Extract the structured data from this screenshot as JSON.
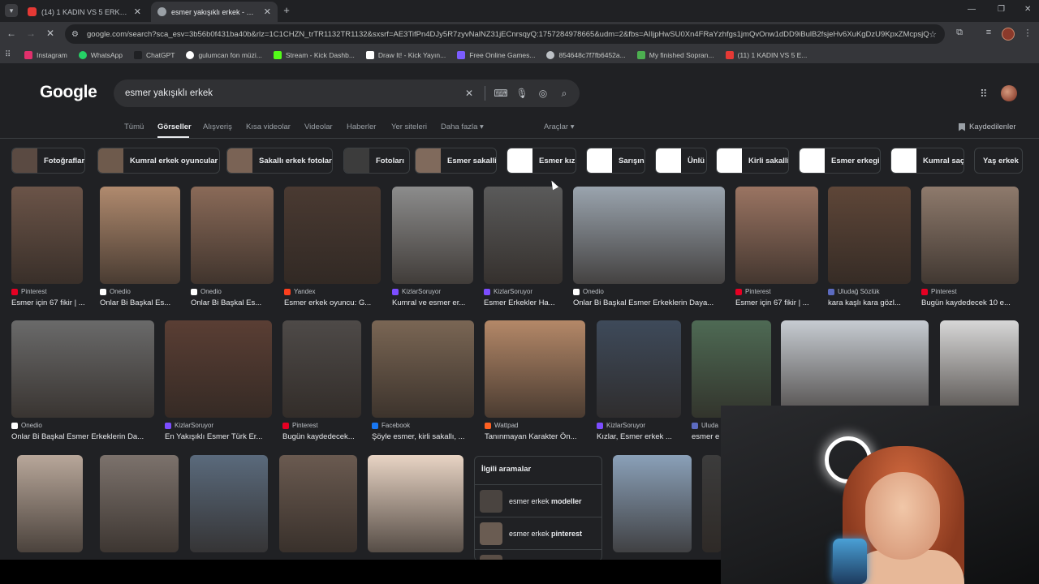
{
  "browser": {
    "tabs": [
      {
        "label": "(14) 1 KADIN VS 5 ERKEK | KIYA",
        "favicon_color": "#e53935",
        "active": false
      },
      {
        "label": "esmer yakışıklı erkek - Google'd",
        "favicon_color": "#9aa0a6",
        "active": true
      }
    ],
    "url": "google.com/search?sca_esv=3b56b0f431ba40b&rlz=1C1CHZN_trTR1132TR1132&sxsrf=AE3TifPn4DJy5R7zyvNalNZ31jECnrsqyQ:1757284978665&udm=2&fbs=AIIjpHwSU0Xn4FRaYzhfgs1jmQvOnw1dDD9iBulB2fsjeHv6XuKgDzU9KpxZMcpsjQNb1...",
    "bookmarks": [
      {
        "label": "Instagram",
        "color": "#e1306c"
      },
      {
        "label": "WhatsApp",
        "color": "#25d366"
      },
      {
        "label": "ChatGPT",
        "color": "#202124"
      },
      {
        "label": "gulumcan fon müzi...",
        "color": "#ffffff"
      },
      {
        "label": "Stream - Kick Dashb...",
        "color": "#53fc18"
      },
      {
        "label": "Draw It! - Kick Yayın...",
        "color": "#ffffff"
      },
      {
        "label": "Free Online Games...",
        "color": "#7b5cff"
      },
      {
        "label": "854648c7f7fb6452a...",
        "color": "#bdc1c6"
      },
      {
        "label": "My finished Sopran...",
        "color": "#4caf50"
      },
      {
        "label": "(11) 1 KADIN VS 5 E...",
        "color": "#e53935"
      }
    ]
  },
  "google": {
    "logo": "Google",
    "query": "esmer yakışıklı erkek",
    "nav_tabs": [
      "Tümü",
      "Görseller",
      "Alışveriş",
      "Kısa videolar",
      "Videolar",
      "Haberler",
      "Yer siteleri",
      "Daha fazla"
    ],
    "tools": "Araçlar",
    "saved": "Kaydedilenler",
    "chips": [
      {
        "label": "Fotoğrafları",
        "color": "#5a4a42"
      },
      {
        "label": "Kumral erkek oyuncular",
        "color": "#6e5a4c"
      },
      {
        "label": "Sakallı erkek fotoları",
        "color": "#7a6355"
      },
      {
        "label": "Fotoları",
        "color": "#3c3c3c"
      },
      {
        "label": "Esmer sakalli",
        "color": "#806a5c"
      },
      {
        "label": "Esmer kız",
        "color": "#ffffff"
      },
      {
        "label": "Sarışın",
        "color": "#ffffff"
      },
      {
        "label": "Ünlü",
        "color": "#ffffff"
      },
      {
        "label": "Kirli sakalli",
        "color": "#ffffff"
      },
      {
        "label": "Esmer erkegi",
        "color": "#ffffff"
      },
      {
        "label": "Kumral saç",
        "color": "#ffffff"
      },
      {
        "label": "Yaş erkek",
        "color": "#ffffff"
      }
    ],
    "row1": [
      {
        "source": "Pinterest",
        "caption": "Esmer için 67 fikir | ...",
        "src_color": "#e60023",
        "img": "#6b5448"
      },
      {
        "source": "Onedio",
        "caption": "Onlar Bi Başkal Es...",
        "src_color": "#ffffff",
        "img": "#b08a6e"
      },
      {
        "source": "Onedio",
        "caption": "Onlar Bi Başkal Es...",
        "src_color": "#ffffff",
        "img": "#8a6a58"
      },
      {
        "source": "Yandex",
        "caption": "Esmer erkek oyuncu: G...",
        "src_color": "#fc3f1d",
        "img": "#4a3a32"
      },
      {
        "source": "KizlarSoruyor",
        "caption": "Kumral ve esmer er...",
        "src_color": "#7c4dff",
        "img": "#8c8c8c"
      },
      {
        "source": "KizlarSoruyor",
        "caption": "Esmer Erkekler Ha...",
        "src_color": "#7c4dff",
        "img": "#5a5a5a"
      },
      {
        "source": "Onedio",
        "caption": "Onlar Bi Başkal Esmer Erkeklerin Daya...",
        "src_color": "#ffffff",
        "img": "#9aa4ae"
      },
      {
        "source": "Pinterest",
        "caption": "Esmer için 67 fikir | ...",
        "src_color": "#e60023",
        "img": "#9a7462"
      },
      {
        "source": "Uludağ Sözlük",
        "caption": "kara kaşlı kara gözl...",
        "src_color": "#5c6bc0",
        "img": "#5e4638"
      },
      {
        "source": "Pinterest",
        "caption": "Bugün kaydedecek 10 e...",
        "src_color": "#e60023",
        "img": "#8e7a6c"
      }
    ],
    "row2": [
      {
        "source": "Onedio",
        "caption": "Onlar Bi Başkal Esmer Erkeklerin Da...",
        "src_color": "#ffffff",
        "img": "#6a6a6a"
      },
      {
        "source": "KizlarSoruyor",
        "caption": "En Yakışıklı Esmer Türk Er...",
        "src_color": "#7c4dff",
        "img": "#5a3e34"
      },
      {
        "source": "Pinterest",
        "caption": "Bugün kaydedecek...",
        "src_color": "#e60023",
        "img": "#4e4a48"
      },
      {
        "source": "Facebook",
        "caption": "Şöyle esmer, kirli sakallı, ...",
        "src_color": "#1877f2",
        "img": "#7a6654"
      },
      {
        "source": "Wattpad",
        "caption": "Tanınmayan Karakter Ön...",
        "src_color": "#ff6122",
        "img": "#b48868"
      },
      {
        "source": "KizlarSoruyor",
        "caption": "Kızlar, Esmer erkek ...",
        "src_color": "#7c4dff",
        "img": "#3e4a5a"
      },
      {
        "source": "Uluda",
        "caption": "esmer e",
        "src_color": "#5c6bc0",
        "img": "#4e6a54"
      },
      {
        "source": "",
        "caption": "",
        "src_color": "#202124",
        "img": "#c7ccd2"
      },
      {
        "source": "",
        "caption": "",
        "src_color": "#202124",
        "img": "#d7d7d7"
      }
    ],
    "row3": [
      {
        "img": "#b8a79a"
      },
      {
        "img": "#7c726c"
      },
      {
        "img": "#5a6a7c"
      },
      {
        "img": "#6a5a50"
      },
      {
        "img": "#e8d4c4"
      },
      {
        "img": "#8aa0b8"
      },
      {
        "img": "#3c3c3c"
      }
    ],
    "related": {
      "title": "İlgili aramalar",
      "items": [
        {
          "prefix": "esmer erkek ",
          "bold": "modeller",
          "img": "#4a4440"
        },
        {
          "prefix": "esmer erkek ",
          "bold": "pinterest",
          "img": "#6a5c52"
        }
      ]
    }
  },
  "icons": {
    "back": "arrow-left",
    "forward": "arrow-right",
    "reload": "reload",
    "clear": "close",
    "keyboard": "keyboard",
    "mic": "microphone",
    "lens": "camera",
    "search": "magnifier"
  }
}
